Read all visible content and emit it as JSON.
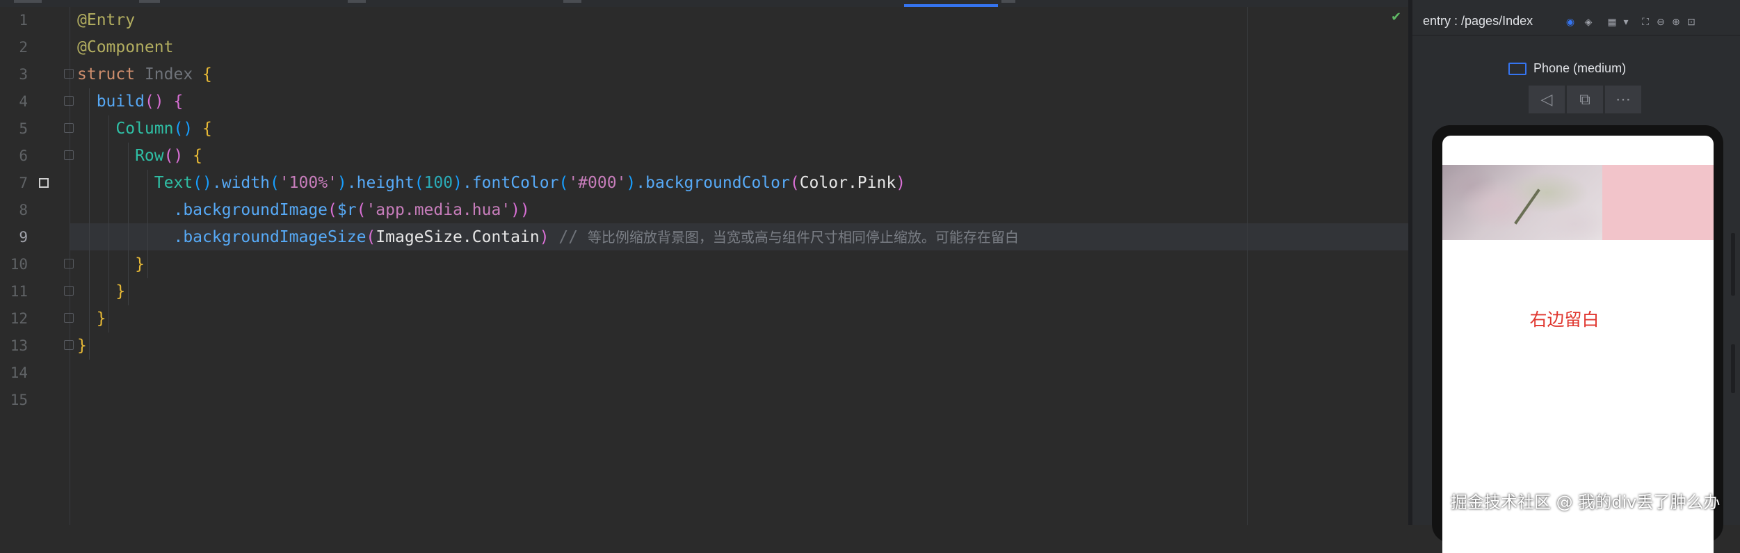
{
  "editor": {
    "line_numbers": [
      "1",
      "2",
      "3",
      "4",
      "5",
      "6",
      "7",
      "8",
      "9",
      "10",
      "11",
      "12",
      "13",
      "14",
      "15"
    ],
    "current_line": 9,
    "lines": [
      [
        {
          "t": "@Entry",
          "c": "c-ann"
        }
      ],
      [
        {
          "t": "@Component",
          "c": "c-ann"
        }
      ],
      [
        {
          "t": "struct ",
          "c": "c-kw"
        },
        {
          "t": "Index ",
          "c": "c-type"
        },
        {
          "t": "{",
          "c": "c-br1"
        }
      ],
      [
        {
          "t": "  build",
          "c": "c-fn"
        },
        {
          "t": "() ",
          "c": "c-br2"
        },
        {
          "t": "{",
          "c": "c-br2"
        }
      ],
      [
        {
          "t": "    Column",
          "c": "c-teal"
        },
        {
          "t": "() ",
          "c": "c-br3"
        },
        {
          "t": "{",
          "c": "c-br1"
        }
      ],
      [
        {
          "t": "      Row",
          "c": "c-teal"
        },
        {
          "t": "() ",
          "c": "c-br2"
        },
        {
          "t": "{",
          "c": "c-br1"
        }
      ],
      [
        {
          "t": "        Text",
          "c": "c-teal"
        },
        {
          "t": "()",
          "c": "c-br3"
        },
        {
          "t": ".width",
          "c": "c-fnc"
        },
        {
          "t": "(",
          "c": "c-br3"
        },
        {
          "t": "'100%'",
          "c": "c-str"
        },
        {
          "t": ")",
          "c": "c-br3"
        },
        {
          "t": ".height",
          "c": "c-fnc"
        },
        {
          "t": "(",
          "c": "c-br3"
        },
        {
          "t": "100",
          "c": "c-num"
        },
        {
          "t": ")",
          "c": "c-br3"
        },
        {
          "t": ".fontColor",
          "c": "c-fnc"
        },
        {
          "t": "(",
          "c": "c-br3"
        },
        {
          "t": "'#000'",
          "c": "c-str"
        },
        {
          "t": ")",
          "c": "c-br3"
        },
        {
          "t": ".backgroundColor",
          "c": "c-fnc"
        },
        {
          "t": "(",
          "c": "c-br2"
        },
        {
          "t": "Color.Pink",
          "c": "c-white"
        },
        {
          "t": ")",
          "c": "c-br2"
        }
      ],
      [
        {
          "t": "          .backgroundImage",
          "c": "c-fnc"
        },
        {
          "t": "(",
          "c": "c-br2"
        },
        {
          "t": "$r",
          "c": "c-fnc"
        },
        {
          "t": "(",
          "c": "c-br2"
        },
        {
          "t": "'app.media.hua'",
          "c": "c-str"
        },
        {
          "t": "))",
          "c": "c-br2"
        }
      ],
      [
        {
          "t": "          .backgroundImageSize",
          "c": "c-fnc"
        },
        {
          "t": "(",
          "c": "c-br2"
        },
        {
          "t": "ImageSize.Contain",
          "c": "c-white"
        },
        {
          "t": ") ",
          "c": "c-br2"
        },
        {
          "t": "// ",
          "c": "c-type"
        },
        {
          "t": "等比例缩放背景图，当宽或高与组件尺寸相同停止缩放。可能存在留白",
          "c": "c-cmt"
        }
      ],
      [
        {
          "t": "      }",
          "c": "c-br1"
        }
      ],
      [
        {
          "t": "    }",
          "c": "c-br1"
        }
      ],
      [
        {
          "t": "  }",
          "c": "c-br1"
        }
      ],
      [
        {
          "t": "}",
          "c": "c-br1"
        }
      ],
      [],
      []
    ]
  },
  "preview": {
    "title": "entry : /pages/Index",
    "device_label": "Phone (medium)",
    "screen_caption": "右边留白",
    "text_background": "#f2c4ca",
    "caption_color": "#e0372f",
    "toolbar_icons": [
      "eye-icon",
      "layers-icon",
      "grid-icon",
      "chevron-down-icon",
      "crop-icon",
      "zoom-out-icon",
      "zoom-in-icon",
      "fit-icon"
    ],
    "device_tools": [
      "back-icon",
      "rotate-icon",
      "more-icon"
    ]
  },
  "watermark": "掘金技术社区 @ 我的div丢了肿么办"
}
